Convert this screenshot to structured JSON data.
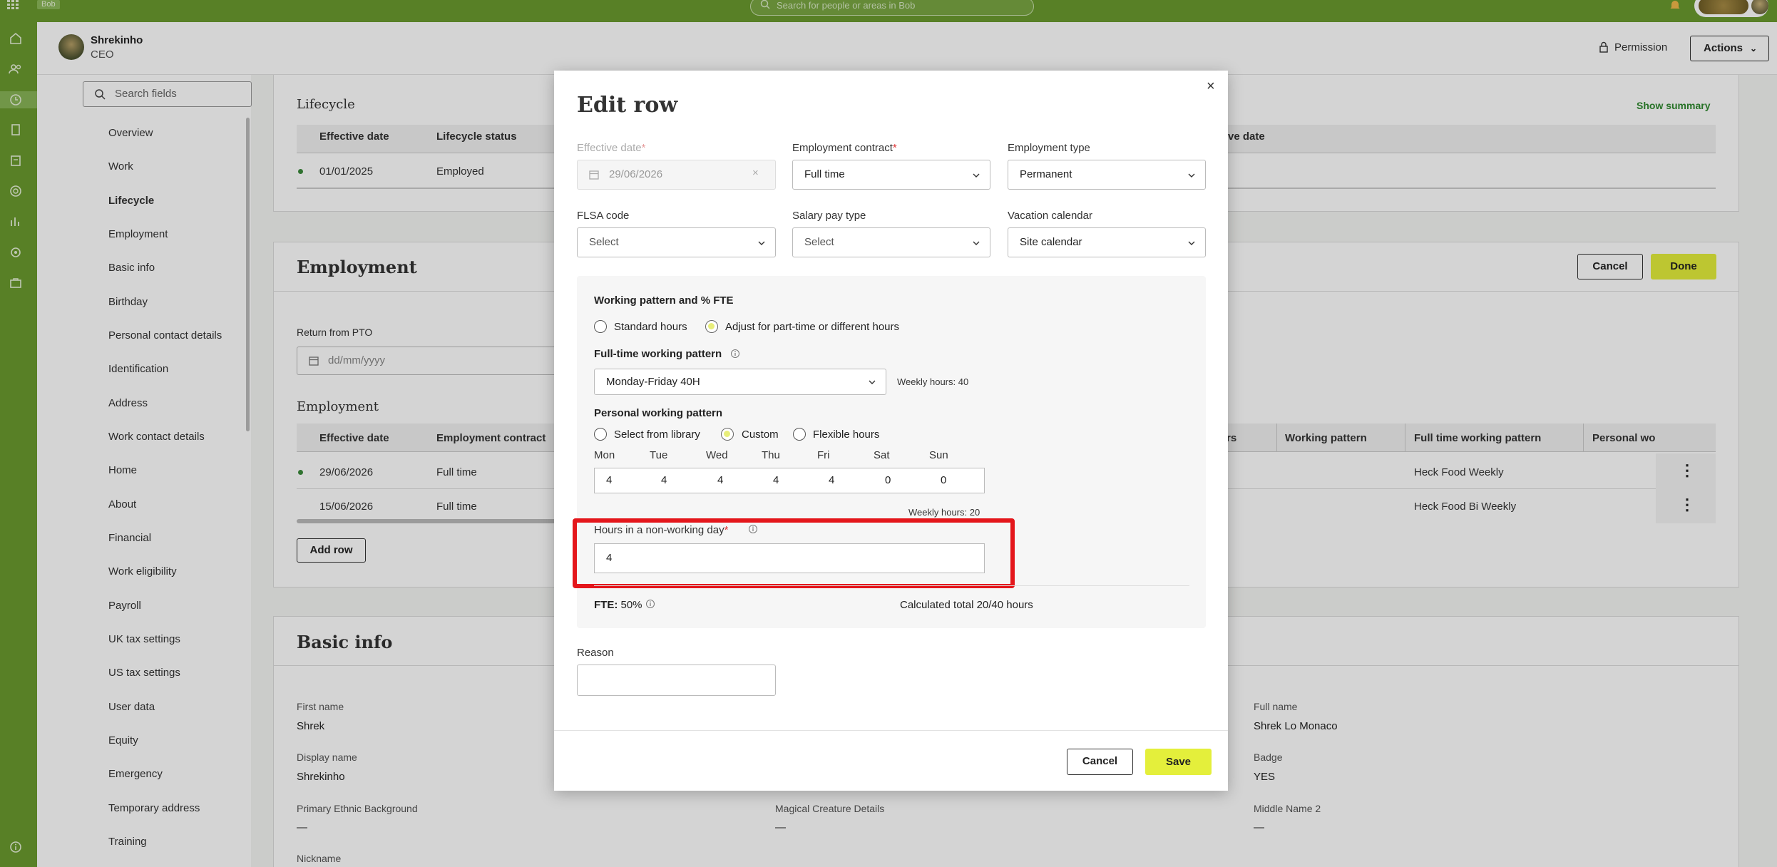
{
  "topbar": {
    "app_name": "Bob",
    "search_placeholder": "Search for people or areas in Bob"
  },
  "rail_icons": [
    "home-icon",
    "people-icon",
    "clock-icon",
    "docs-icon",
    "clipboard-icon",
    "target-icon",
    "chart-icon",
    "gear-icon",
    "briefcase-icon",
    "info-icon"
  ],
  "profile": {
    "name": "Shrekinho",
    "role": "CEO",
    "permission_label": "Permission",
    "actions_label": "Actions"
  },
  "sidenav": {
    "search_placeholder": "Search fields",
    "items": [
      "Overview",
      "Work",
      "Lifecycle",
      "Employment",
      "Basic info",
      "Birthday",
      "Personal contact details",
      "Identification",
      "Address",
      "Work contact details",
      "Home",
      "About",
      "Financial",
      "Work eligibility",
      "Payroll",
      "UK tax settings",
      "US tax settings",
      "User data",
      "Equity",
      "Emergency",
      "Temporary address",
      "Training"
    ],
    "active": "Lifecycle"
  },
  "lifecycle": {
    "title": "Lifecycle",
    "show_summary": "Show summary",
    "columns": [
      "Effective date",
      "Lifecycle status"
    ],
    "right_column": "ve date",
    "row": {
      "date": "01/01/2025",
      "status": "Employed"
    }
  },
  "employment": {
    "title": "Employment",
    "cancel_label": "Cancel",
    "done_label": "Done",
    "return_label": "Return from PTO",
    "return_placeholder": "dd/mm/yyyy",
    "subtitle": "Employment",
    "columns": [
      "Effective date",
      "Employment contract"
    ],
    "right_columns": [
      "rs",
      "Working pattern",
      "Full time working pattern",
      "Personal wo"
    ],
    "rows": [
      {
        "date": "29/06/2026",
        "contract": "Full time",
        "ft_pattern": "Heck Food Weekly"
      },
      {
        "date": "15/06/2026",
        "contract": "Full time",
        "ft_pattern": "Heck Food Bi Weekly"
      }
    ],
    "add_row": "Add row"
  },
  "basic_info": {
    "title": "Basic info",
    "first_name_label": "First name",
    "first_name": "Shrek",
    "display_name_label": "Display name",
    "display_name": "Shrekinho",
    "ethnic_label": "Primary Ethnic Background",
    "ethnic": "—",
    "magical_label": "Magical Creature Details",
    "magical": "—",
    "nickname_label": "Nickname",
    "full_name_label": "Full name",
    "full_name": "Shrek Lo Monaco",
    "badge_label": "Badge",
    "badge": "YES",
    "middle_label": "Middle Name 2",
    "middle": "—"
  },
  "modal": {
    "title": "Edit row",
    "close": "×",
    "effective_date": {
      "label": "Effective date",
      "value": "29/06/2026"
    },
    "employment_contract": {
      "label": "Employment contract",
      "value": "Full time"
    },
    "employment_type": {
      "label": "Employment type",
      "value": "Permanent"
    },
    "flsa": {
      "label": "FLSA code",
      "value": "Select"
    },
    "salary_pay": {
      "label": "Salary pay type",
      "value": "Select"
    },
    "vacation": {
      "label": "Vacation calendar",
      "value": "Site calendar"
    },
    "working_pattern": {
      "title": "Working pattern and % FTE",
      "standard": "Standard hours",
      "adjust": "Adjust for part-time or different hours",
      "selected": "adjust",
      "ft_label": "Full-time working pattern",
      "ft_value": "Monday-Friday 40H",
      "weekly_hours": "Weekly hours: 40",
      "personal_label": "Personal working pattern",
      "from_library": "Select from library",
      "custom": "Custom",
      "flexible": "Flexible hours",
      "personal_selected": "custom",
      "days": [
        {
          "name": "Mon",
          "hours": "4"
        },
        {
          "name": "Tue",
          "hours": "4"
        },
        {
          "name": "Wed",
          "hours": "4"
        },
        {
          "name": "Thu",
          "hours": "4"
        },
        {
          "name": "Fri",
          "hours": "4"
        },
        {
          "name": "Sat",
          "hours": "0"
        },
        {
          "name": "Sun",
          "hours": "0"
        }
      ],
      "personal_weekly": "Weekly hours: 20",
      "nonworking_label": "Hours in a non-working day",
      "nonworking_value": "4",
      "fte_label": "FTE:",
      "fte_value": "50%",
      "calc_total": "Calculated total 20/40 hours"
    },
    "reason_label": "Reason",
    "cancel_label": "Cancel",
    "save_label": "Save"
  },
  "colors": {
    "brand_green": "#6a9a2e",
    "accent_yellow": "#e4ef3b",
    "highlight_red": "#e4161b",
    "link_green": "#2f8a2f"
  }
}
